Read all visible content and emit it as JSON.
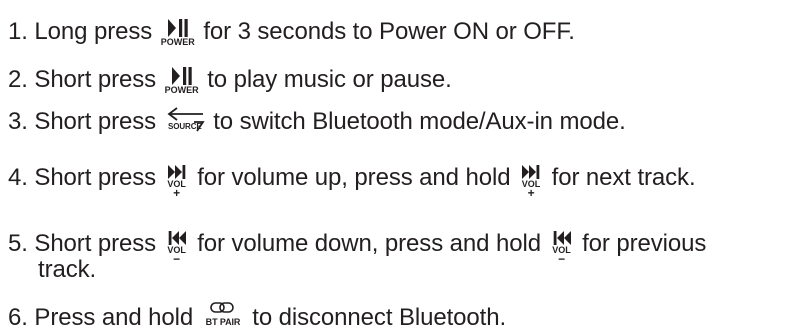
{
  "instructions": [
    {
      "number": "1.",
      "before": "Long press",
      "icon_name": "play-pause-icon",
      "icon_caption": "POWER",
      "after": "for 3 seconds to Power ON or OFF."
    },
    {
      "number": "2.",
      "before": "Short press",
      "icon_name": "play-pause-icon",
      "icon_caption": "POWER",
      "after": "to play music or pause."
    },
    {
      "number": "3.",
      "before": "Short press",
      "icon_name": "source-switch-icon",
      "icon_caption": "SOURCE",
      "after": "to switch Bluetooth mode/Aux-in mode."
    },
    {
      "number": "4.",
      "before": "Short press",
      "icon_name": "next-track-icon",
      "icon_caption": "VOL",
      "icon_sign": "+",
      "middle": "for volume up, press and hold",
      "after": "for next track."
    },
    {
      "number": "5.",
      "before": "Short press",
      "icon_name": "previous-track-icon",
      "icon_caption": "VOL",
      "icon_sign": "−",
      "middle": "for volume down, press and hold",
      "after": "for previous",
      "continuation": "track."
    },
    {
      "number": "6.",
      "before": "Press and hold",
      "icon_name": "bt-pair-link-icon",
      "icon_caption": "BT PAIR",
      "after": "to disconnect Bluetooth."
    }
  ]
}
